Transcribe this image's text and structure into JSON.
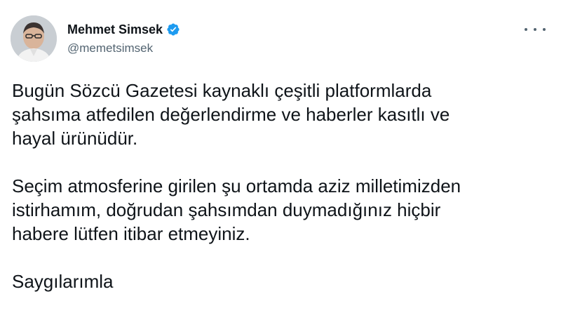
{
  "author": {
    "display_name": "Mehmet Simsek",
    "handle": "@memetsimsek",
    "verified": true
  },
  "icons": {
    "avatar": "profile-photo",
    "verified": "verified-badge-icon",
    "more": "more-options-icon"
  },
  "colors": {
    "text": "#0f1419",
    "secondary_text": "#536471",
    "verified_blue": "#1d9bf0",
    "background": "#ffffff"
  },
  "tweet": {
    "paragraphs": [
      [
        "Bugün Sözcü Gazetesi kaynaklı çeşitli platformlarda",
        "şahsıma atfedilen değerlendirme ve haberler kasıtlı ve",
        "hayal ürünüdür."
      ],
      [
        "Seçim atmosferine girilen şu ortamda aziz milletimizden",
        "istirhamım, doğrudan şahsımdan duymadığınız hiçbir",
        "habere lütfen itibar etmeyiniz."
      ],
      [
        "Saygılarımla"
      ]
    ]
  }
}
